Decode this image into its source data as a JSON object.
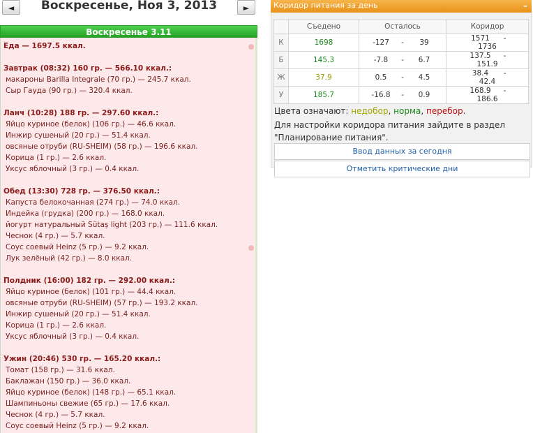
{
  "nav": {
    "prev": "◄",
    "next": "►"
  },
  "date_title": "Воскресенье, Ноя 3, 2013",
  "day_header": "Воскресенье 3.11",
  "total": "Еда — 1697.5 ккал.",
  "meals": [
    {
      "title": "Завтрак (08:32) 160 гр. — 566.10 ккал.:",
      "items": [
        "макароны Barilla Integrale (70 гр.) — 245.7 ккал.",
        "Сыр Гауда (90 гр.) — 320.4 ккал."
      ]
    },
    {
      "title": "Ланч (10:28) 188 гр. — 297.60 ккал.:",
      "items": [
        "Яйцо куриное (белок) (106 гр.) — 46.6 ккал.",
        "Инжир сушеный (20 гр.) — 51.4 ккал.",
        "овсяные отруби (RU-SHEIM) (58 гр.) — 196.6 ккал.",
        "Корица (1 гр.) — 2.6 ккал.",
        "Уксус яблочный (3 гр.) — 0.4 ккал."
      ]
    },
    {
      "title": "Обед (13:30) 728 гр. — 376.50 ккал.:",
      "items": [
        "Капуста белокочанная (274 гр.) — 74.0 ккал.",
        "Индейка (грудка) (200 гр.) — 168.0 ккал.",
        "йогурт натуральный Sütaş light (203 гр.) — 111.6 ккал.",
        "Чеснок (4 гр.) — 5.7 ккал.",
        "Соус соевый Heinz (5 гр.) — 9.2 ккал.",
        "Лук зелёный (42 гр.) — 8.0 ккал."
      ]
    },
    {
      "title": "Полдник (16:00) 182 гр. — 292.00 ккал.:",
      "items": [
        "Яйцо куриное (белок) (101 гр.) — 44.4 ккал.",
        "овсяные отруби (RU-SHEIM) (57 гр.) — 193.2 ккал.",
        "Инжир сушеный (20 гр.) — 51.4 ккал.",
        "Корица (1 гр.) — 2.6 ккал.",
        "Уксус яблочный (3 гр.) — 0.4 ккал."
      ]
    },
    {
      "title": "Ужин (20:46) 530 гр. — 165.20 ккал.:",
      "items": [
        "Томат (158 гр.) — 31.6 ккал.",
        "Баклажан (150 гр.) — 36.0 ккал.",
        "Яйцо куриное (белок) (148 гр.) — 65.1 ккал.",
        "Шампиньоны свежие (65 гр.) — 17.6 ккал.",
        "Чеснок (4 гр.) — 5.7 ккал.",
        "Соус соевый Heinz (5 гр.) — 9.2 ккал."
      ]
    }
  ],
  "corridor": {
    "header": "Коридор питания за день",
    "collapse": "–",
    "columns": [
      "Съедено",
      "Осталось",
      "Коридор"
    ],
    "rows": [
      {
        "label": "К",
        "eaten": "1698",
        "left_min": "-127",
        "left_max": "39",
        "corr_min": "1571",
        "corr_max": "1736",
        "color": "#1a8a1a"
      },
      {
        "label": "Б",
        "eaten": "145.3",
        "left_min": "-7.8",
        "left_max": "6.7",
        "corr_min": "137.5",
        "corr_max": "151.9",
        "color": "#1a8a1a"
      },
      {
        "label": "Ж",
        "eaten": "37.9",
        "left_min": "0.5",
        "left_max": "4.5",
        "corr_min": "38.4",
        "corr_max": "42.4",
        "color": "#9a9a00"
      },
      {
        "label": "У",
        "eaten": "185.7",
        "left_min": "-16.8",
        "left_max": "0.9",
        "corr_min": "168.9",
        "corr_max": "186.6",
        "color": "#1a8a1a"
      }
    ],
    "dash": "-",
    "legend_prefix": "Цвета означают:",
    "legend_nedobor": "недобор",
    "legend_norma": "норма",
    "legend_perebor": "перебор",
    "comma": ",",
    "period": ".",
    "hint": "Для настройки коридора питания зайдите в раздел \"Планирование питания\".",
    "btn_input": "Ввод данных за сегодня",
    "btn_critical": "Отметить критические дни"
  }
}
